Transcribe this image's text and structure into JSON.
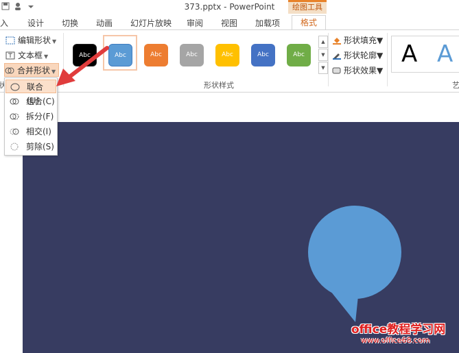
{
  "window": {
    "title": "373.pptx - PowerPoint",
    "context_tab": "绘图工具"
  },
  "tabs": [
    {
      "label": "入"
    },
    {
      "label": "设计"
    },
    {
      "label": "切换"
    },
    {
      "label": "动画"
    },
    {
      "label": "幻灯片放映"
    },
    {
      "label": "审阅"
    },
    {
      "label": "视图"
    },
    {
      "label": "加载项"
    },
    {
      "label": "格式"
    }
  ],
  "insert_shapes": {
    "items": [
      {
        "label": "编辑形状"
      },
      {
        "label": "文本框"
      },
      {
        "label": "合并形状"
      }
    ],
    "group_label_fragment": "状"
  },
  "shape_styles": {
    "group_label": "形状样式",
    "swatches": [
      {
        "label": "Abc",
        "color": "#000000"
      },
      {
        "label": "Abc",
        "color": "#5b9bd5"
      },
      {
        "label": "Abc",
        "color": "#ed7d31"
      },
      {
        "label": "Abc",
        "color": "#a5a5a5"
      },
      {
        "label": "Abc",
        "color": "#ffc000"
      },
      {
        "label": "Abc",
        "color": "#4472c4"
      },
      {
        "label": "Abc",
        "color": "#70ad47"
      }
    ],
    "format_items": [
      {
        "label": "形状填充"
      },
      {
        "label": "形状轮廓"
      },
      {
        "label": "形状效果"
      }
    ]
  },
  "wordart": {
    "sample": "A",
    "group_label_fragment": "艺"
  },
  "merge_menu": {
    "items": [
      {
        "label": "联合(U)"
      },
      {
        "label": "组合(C)"
      },
      {
        "label": "拆分(F)"
      },
      {
        "label": "相交(I)"
      },
      {
        "label": "剪除(S)"
      }
    ]
  },
  "colors": {
    "slide_bg": "#373c61",
    "bubble": "#5b9bd5",
    "accent": "#d2691e",
    "arrow": "#e03c3c"
  },
  "watermark": {
    "line1": "office教程学习网",
    "line2": "www.office68.com"
  }
}
